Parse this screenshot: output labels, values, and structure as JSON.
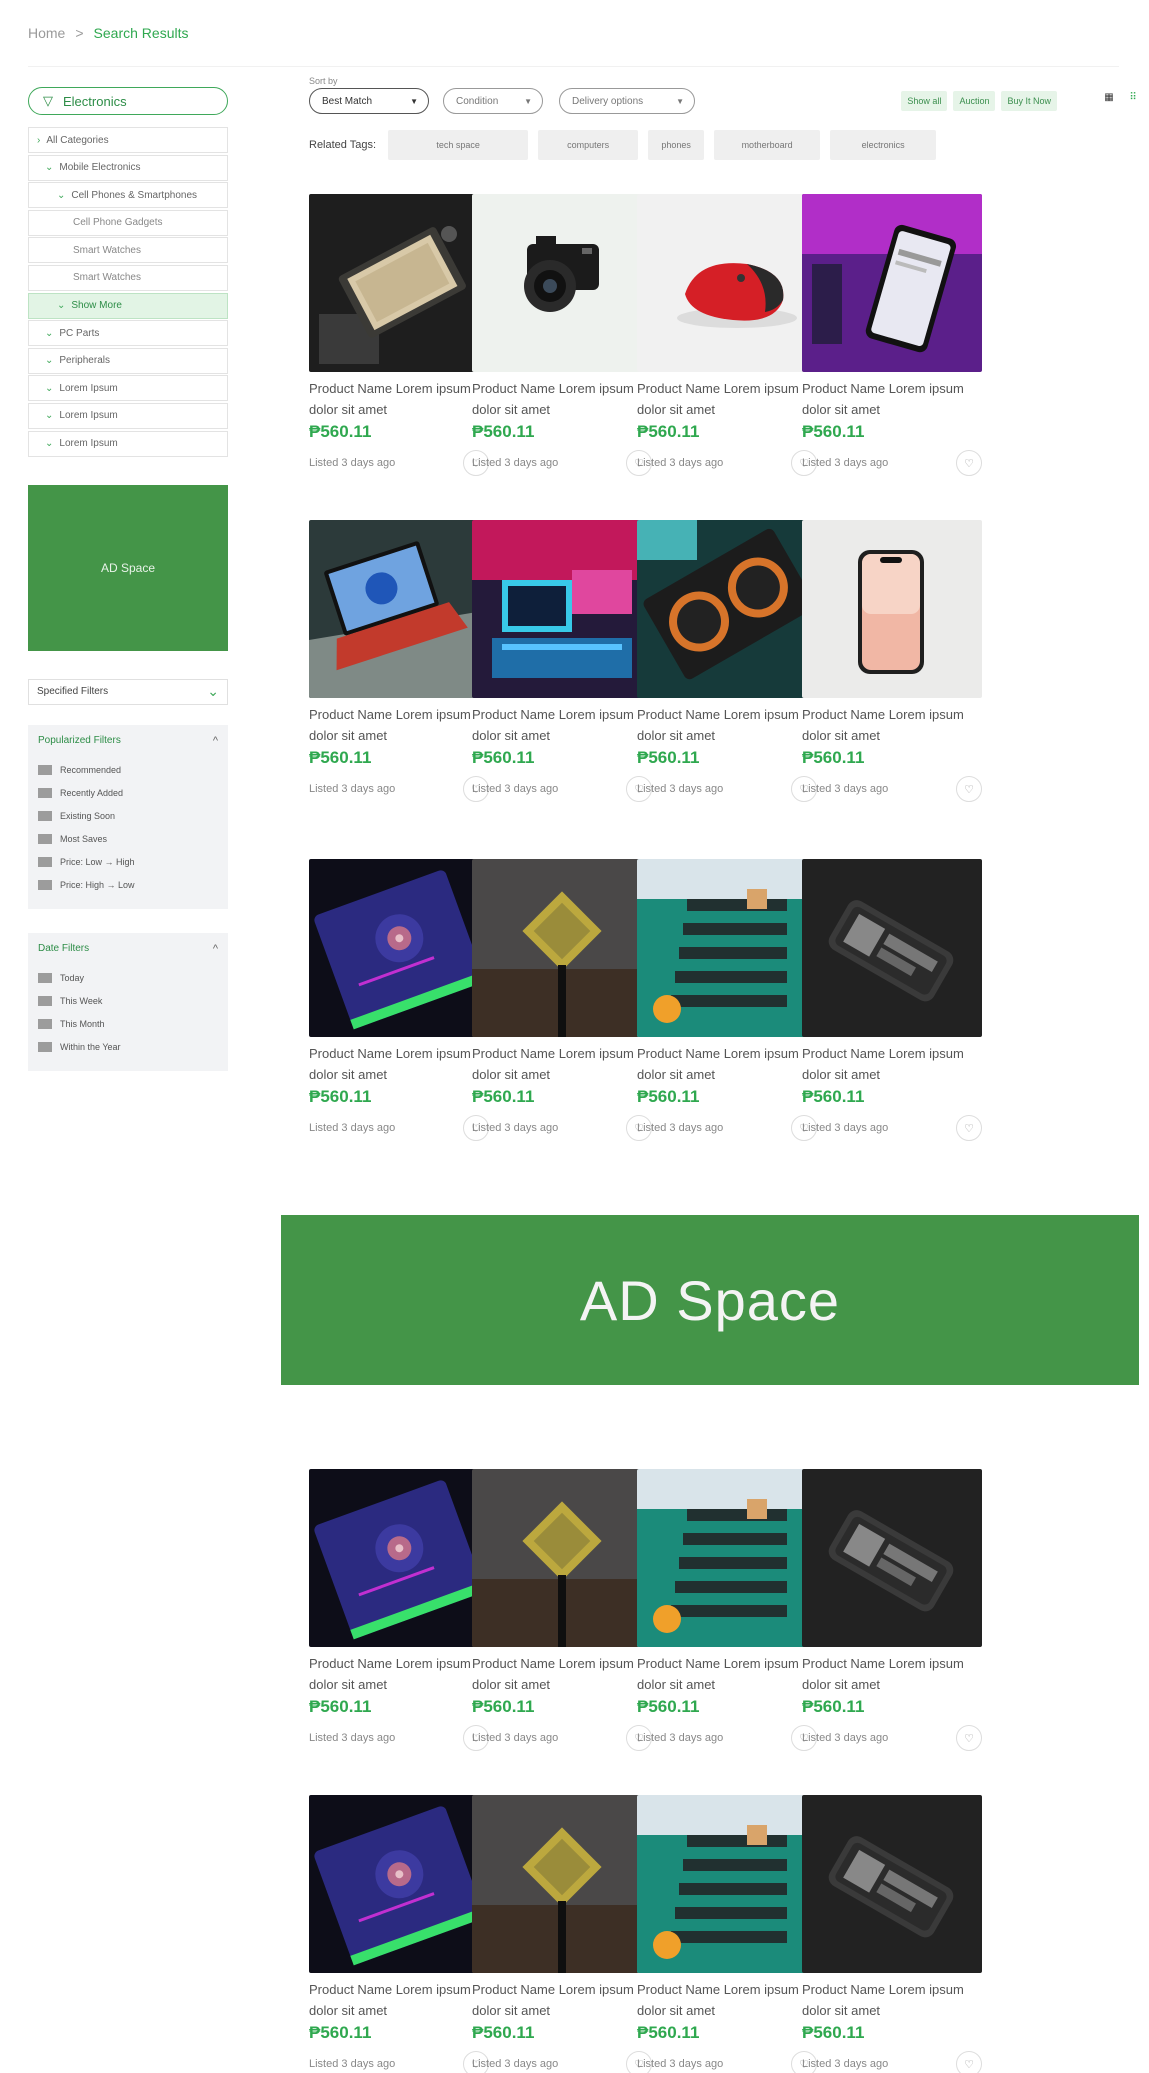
{
  "breadcrumb": {
    "home": "Home",
    "separator": ">",
    "current": "Search Results"
  },
  "sidebar": {
    "category_header": "Electronics",
    "categories": [
      {
        "label": "All Categories",
        "level": 0,
        "chev": ">"
      },
      {
        "label": "Mobile Electronics",
        "level": 1,
        "chev": "v"
      },
      {
        "label": "Cell Phones & Smartphones",
        "level": 2,
        "chev": "v"
      },
      {
        "label": "Cell Phone Gadgets",
        "level": 3,
        "chev": ""
      },
      {
        "label": "Smart Watches",
        "level": 3,
        "chev": ""
      },
      {
        "label": "Smart Watches",
        "level": 3,
        "chev": ""
      },
      {
        "label": "Show More",
        "level": 2,
        "chev": "v",
        "selected": true
      },
      {
        "label": "PC Parts",
        "level": 1,
        "chev": "v"
      },
      {
        "label": "Peripherals",
        "level": 1,
        "chev": "v"
      },
      {
        "label": "Lorem Ipsum",
        "level": 1,
        "chev": "v"
      },
      {
        "label": "Lorem Ipsum",
        "level": 1,
        "chev": "v"
      },
      {
        "label": "Lorem Ipsum",
        "level": 1,
        "chev": "v"
      }
    ],
    "side_ad": "AD Space",
    "specified_filters": "Specified Filters",
    "popularized_filters": {
      "title": "Popularized Filters",
      "options": [
        "Recommended",
        "Recently Added",
        "Existing Soon",
        "Most Saves",
        "Price: Low → High",
        "Price: High → Low"
      ]
    },
    "date_filters": {
      "title": "Date Filters",
      "options": [
        "Today",
        "This Week",
        "This Month",
        "Within the Year"
      ]
    }
  },
  "toolbar": {
    "sort_label": "Sort by",
    "sort_value": "Best Match",
    "condition": "Condition",
    "delivery": "Delivery options",
    "pills": [
      "Show all",
      "Auction",
      "Buy It Now"
    ]
  },
  "related": {
    "label": "Related Tags:",
    "tags": [
      "tech space",
      "computers",
      "phones",
      "motherboard",
      "electronics"
    ]
  },
  "product": {
    "name": "Product Name Lorem ipsum dolor sit amet",
    "price": "₱560.11",
    "listed": "Listed 3 days ago"
  },
  "main_ad": "AD Space",
  "colors": {
    "accent": "#2fa84f",
    "ad_green": "#449548",
    "selected_bg": "#e2f4e5"
  }
}
